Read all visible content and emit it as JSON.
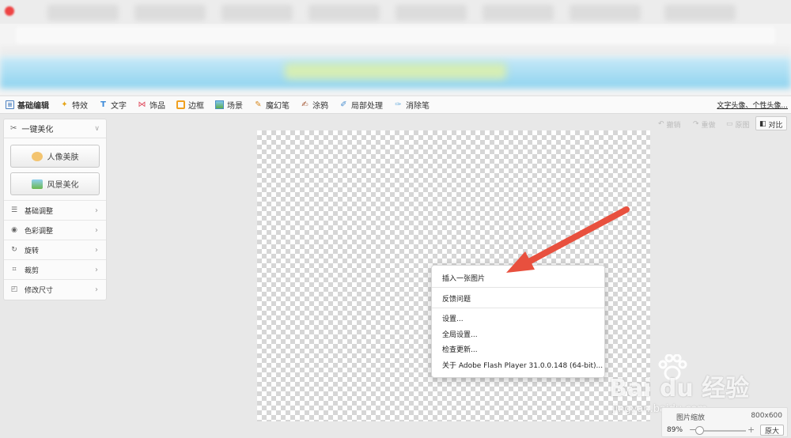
{
  "toolbar": {
    "tools": [
      {
        "label": "基础编辑",
        "icon": "edit-icon"
      },
      {
        "label": "特效",
        "icon": "effect-icon"
      },
      {
        "label": "文字",
        "icon": "text-icon"
      },
      {
        "label": "饰品",
        "icon": "accessory-icon"
      },
      {
        "label": "边框",
        "icon": "frame-icon"
      },
      {
        "label": "场景",
        "icon": "scene-icon"
      },
      {
        "label": "魔幻笔",
        "icon": "magic-pen-icon"
      },
      {
        "label": "涂鸦",
        "icon": "doodle-icon"
      },
      {
        "label": "局部处理",
        "icon": "local-process-icon"
      },
      {
        "label": "消除笔",
        "icon": "eraser-pen-icon"
      }
    ],
    "right_link": "文字头像、个性头像..."
  },
  "left_panel": {
    "header": "一键美化",
    "portrait_button": "人像美肤",
    "scenery_button": "风景美化",
    "items": [
      {
        "label": "基础调整",
        "icon": "sliders-icon"
      },
      {
        "label": "色彩调整",
        "icon": "palette-icon"
      },
      {
        "label": "旋转",
        "icon": "rotate-icon"
      },
      {
        "label": "裁剪",
        "icon": "crop-icon"
      },
      {
        "label": "修改尺寸",
        "icon": "resize-icon"
      }
    ]
  },
  "top_right": {
    "undo": "撤销",
    "redo": "重做",
    "original": "原图",
    "compare": "对比"
  },
  "context_menu": {
    "items": [
      "插入一张图片",
      "反馈问题",
      "设置...",
      "全局设置...",
      "检查更新...",
      "关于 Adobe Flash Player 31.0.0.148 (64-bit)..."
    ]
  },
  "zoom": {
    "label": "图片缩放",
    "size": "800x600",
    "percent": "89%",
    "minus": "−",
    "plus": "+",
    "original_button": "原大",
    "level": 0.89
  },
  "watermark": {
    "brand": "Bai du 经验",
    "url": "jingyan.baidu.com"
  },
  "colors": {
    "arrow": "#e8503e",
    "banner": "#8ed3ef",
    "checker": "#d6d6d6"
  }
}
